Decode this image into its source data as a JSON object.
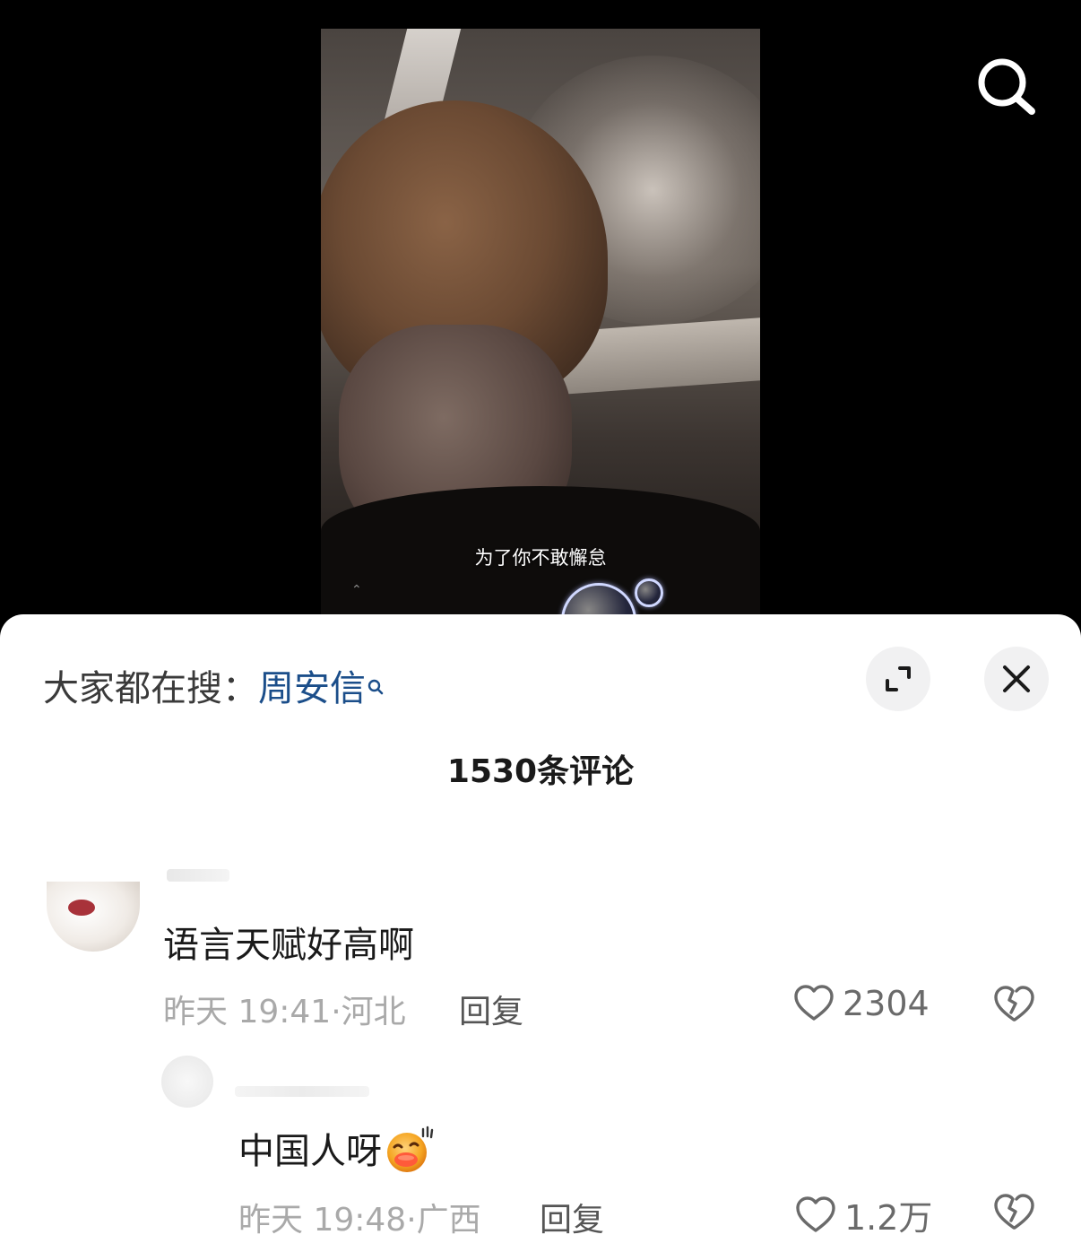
{
  "video": {
    "caption": "为了你不敢懈怠",
    "scroll_hint": "⌃"
  },
  "topbar": {
    "search_icon": "search-icon"
  },
  "sheet": {
    "trending_prefix": "大家都在搜：",
    "trending_keyword": "周安信",
    "comment_count": "1530条评论",
    "expand_icon": "expand-icon",
    "close_icon": "close-icon"
  },
  "comments": [
    {
      "text": "语言天赋好高啊",
      "time": "昨天 19:41",
      "location": "河北",
      "reply_label": "回复",
      "likes": "2304"
    },
    {
      "text": "中国人呀",
      "emoji": "grinning-face-emoji",
      "time": "昨天 19:48",
      "location": "广西",
      "reply_label": "回复",
      "likes": "1.2万"
    }
  ],
  "colors": {
    "keyword": "#1b4e8a",
    "meta": "#a9a9a9",
    "text": "#1a1a1a"
  }
}
